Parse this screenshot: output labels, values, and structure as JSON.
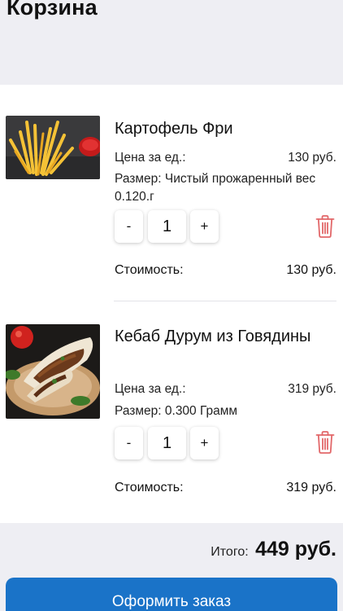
{
  "header": {
    "title": "Корзина"
  },
  "items": [
    {
      "name": "Картофель Фри",
      "price_label": "Цена за ед.:",
      "price": "130 руб.",
      "size": "Размер: Чистый прожаренный вес 0.120.г",
      "minus": "-",
      "qty": "1",
      "plus": "+",
      "cost_label": "Стоимость:",
      "cost": "130 руб.",
      "image_icon": "fries-image"
    },
    {
      "name": "Кебаб Дурум из Говядины",
      "price_label": "Цена за ед.:",
      "price": "319 руб.",
      "size": "Размер: 0.300 Грамм",
      "minus": "-",
      "qty": "1",
      "plus": "+",
      "cost_label": "Стоимость:",
      "cost": "319 руб.",
      "image_icon": "kebab-image"
    }
  ],
  "summary": {
    "total_label": "Итого:",
    "total": "449 руб."
  },
  "checkout": {
    "label": "Оформить заказ"
  },
  "colors": {
    "accent": "#1a73c8",
    "trash": "#e2686a",
    "background": "#eeeef3"
  }
}
